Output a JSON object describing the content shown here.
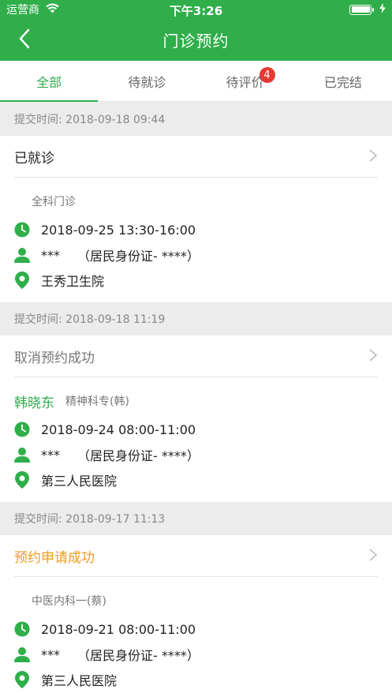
{
  "status_bar": {
    "carrier": "运营商",
    "time": "下午3:26"
  },
  "nav": {
    "title": "门诊预约"
  },
  "tabs": [
    {
      "label": "全部",
      "active": true
    },
    {
      "label": "待就诊",
      "active": false
    },
    {
      "label": "待评价",
      "active": false,
      "badge": "4"
    },
    {
      "label": "已完结",
      "active": false
    }
  ],
  "appointments": [
    {
      "submit_time": "提交时间: 2018-09-18 09:44",
      "status": "已就诊",
      "department": "全科门诊",
      "datetime": "2018-09-25 13:30-16:00",
      "patient": "***",
      "id_info": "（居民身份证-  ****）",
      "hospital": "王秀卫生院"
    },
    {
      "submit_time": "提交时间: 2018-09-18 11:19",
      "status": "取消预约成功",
      "doctor": "韩晓东",
      "department": "精神科专(韩)",
      "datetime": "2018-09-24 08:00-11:00",
      "patient": "***",
      "id_info": "（居民身份证-  ****）",
      "hospital": "第三人民医院"
    },
    {
      "submit_time": "提交时间: 2018-09-17 11:13",
      "status": "预约申请成功",
      "department": "中医内科一(蔡)",
      "datetime": "2018-09-21 08:00-11:00",
      "patient": "***",
      "id_info": "（居民身份证-  ****）",
      "hospital": "第三人民医院"
    }
  ],
  "colors": {
    "brand_green": "#2fae4a",
    "badge_red": "#e53935",
    "status_orange": "#f39a1d"
  },
  "icons": {
    "back": "chevron-left-icon",
    "clock": "clock-icon",
    "person": "person-icon",
    "location": "location-pin-icon",
    "row_arrow": "chevron-right-icon",
    "wifi": "wifi-icon",
    "battery": "battery-icon",
    "charging": "charging-bolt-icon"
  }
}
